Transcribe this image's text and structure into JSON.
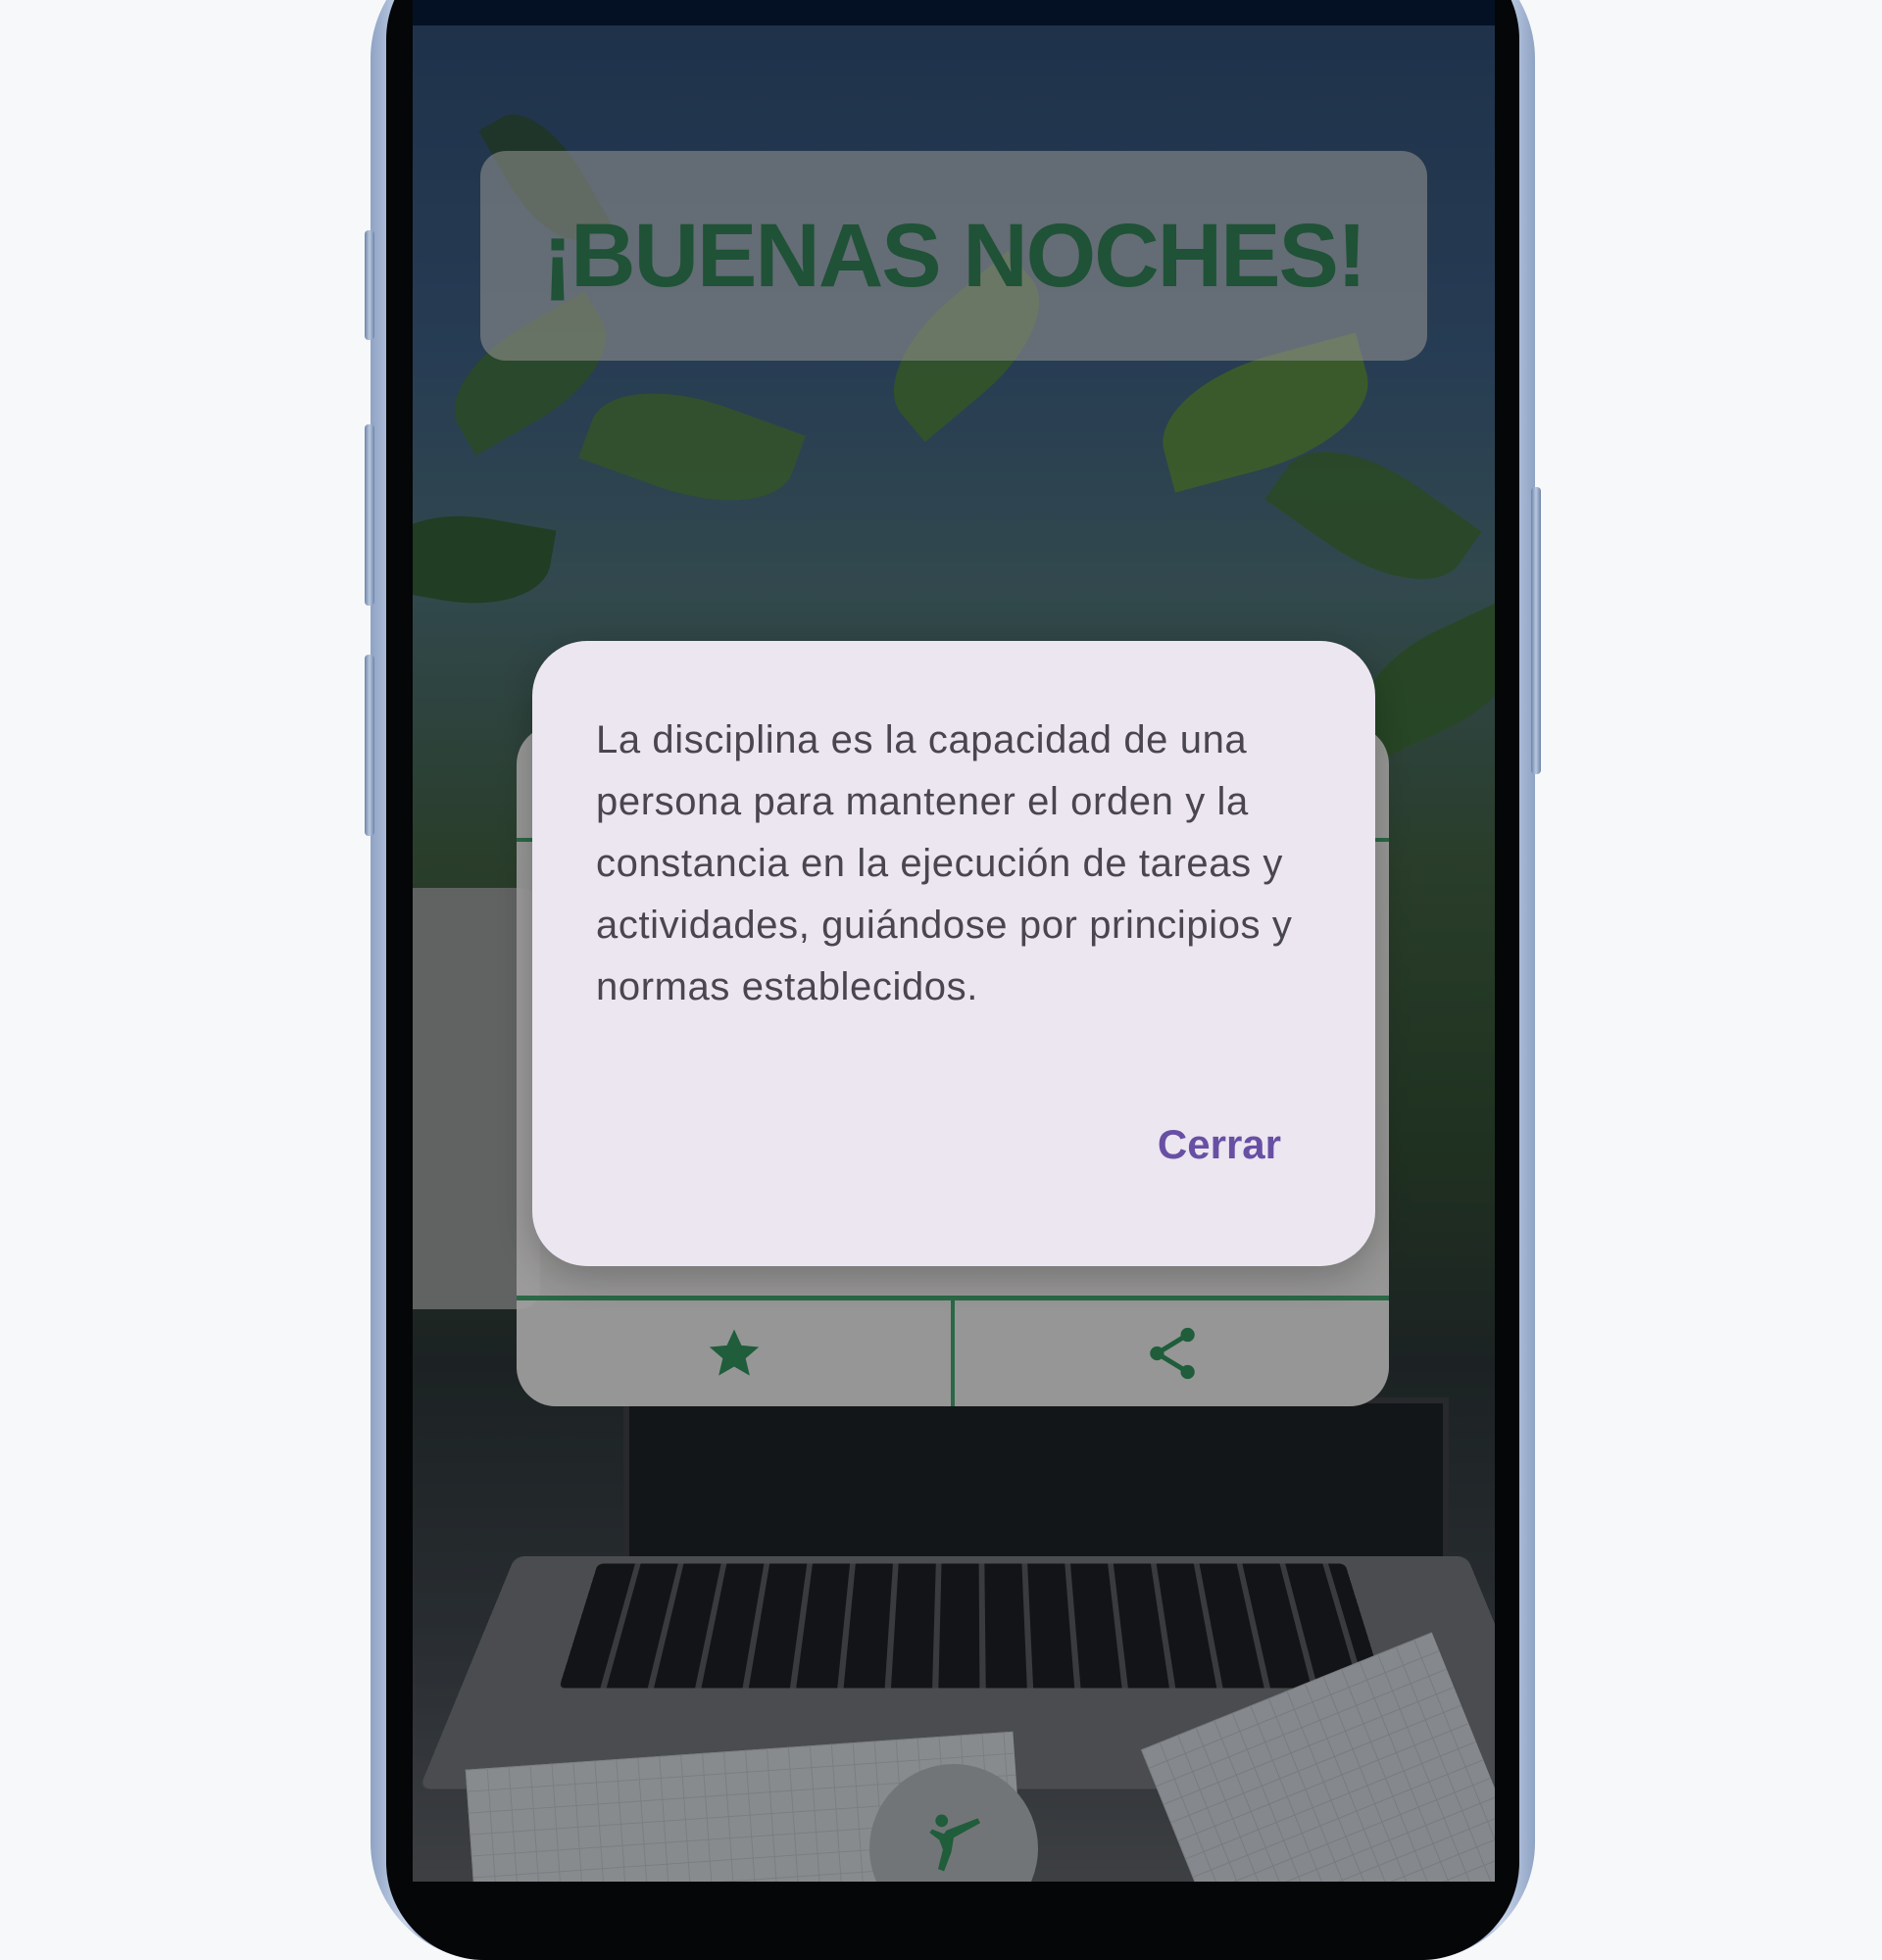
{
  "app": {
    "greeting": "¡BUENAS NOCHES!"
  },
  "quote_card": {
    "actions": [
      {
        "icon": "star-icon",
        "label": ""
      },
      {
        "icon": "share-icon",
        "label": ""
      }
    ]
  },
  "dialog": {
    "message": "La disciplina es la capacidad de una persona para mantener el orden y la constancia en la ejecución de tareas y actividades, guiándose por principios y normas establecidos.",
    "close_label": "Cerrar"
  },
  "fab": {
    "icon": "martial-arts-kick-icon"
  },
  "colors": {
    "accent_green": "#2f7a50",
    "divider_green": "#3e9a67",
    "dialog_bg": "#ece6f0",
    "dialog_button": "#6750a4"
  }
}
